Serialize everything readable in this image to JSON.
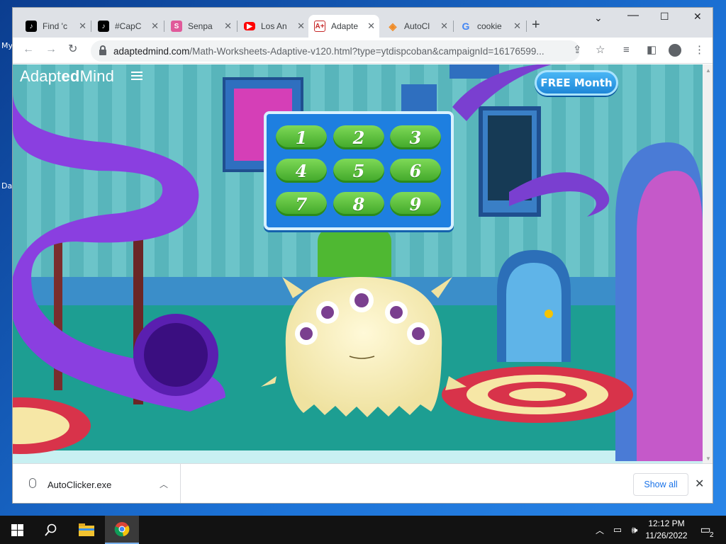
{
  "tabs": [
    {
      "title": "Find 'c",
      "favicon": "tiktok-icon"
    },
    {
      "title": "#CapC",
      "favicon": "tiktok-icon"
    },
    {
      "title": "Senpa",
      "favicon": "senpai-icon"
    },
    {
      "title": "Los An",
      "favicon": "youtube-icon"
    },
    {
      "title": "Adapte",
      "favicon": "adaptedmind-icon",
      "active": true
    },
    {
      "title": "AutoCl",
      "favicon": "autoclicker-icon"
    },
    {
      "title": "cookie",
      "favicon": "google-icon"
    }
  ],
  "omnibox": {
    "domain": "adaptedmind.com",
    "path": "/Math-Worksheets-Adaptive-v120.html?type=ytdispcoban&campaignId=16176599..."
  },
  "page": {
    "logo_prefix": "Adapt",
    "logo_bold": "ed",
    "logo_suffix": "Mind",
    "free_button": "FREE Month",
    "levels": [
      "1",
      "2",
      "3",
      "4",
      "5",
      "6",
      "7",
      "8",
      "9"
    ]
  },
  "downloads": {
    "file": "AutoClicker.exe",
    "show_all": "Show all"
  },
  "desktop": {
    "edge_labels": [
      "My",
      "Da"
    ]
  },
  "taskbar": {
    "time": "12:12 PM",
    "date": "11/26/2022",
    "notifications": "2"
  },
  "colors": {
    "level_button": "#4fb832",
    "panel": "#1e7fe0",
    "taskbar": "#121212"
  }
}
